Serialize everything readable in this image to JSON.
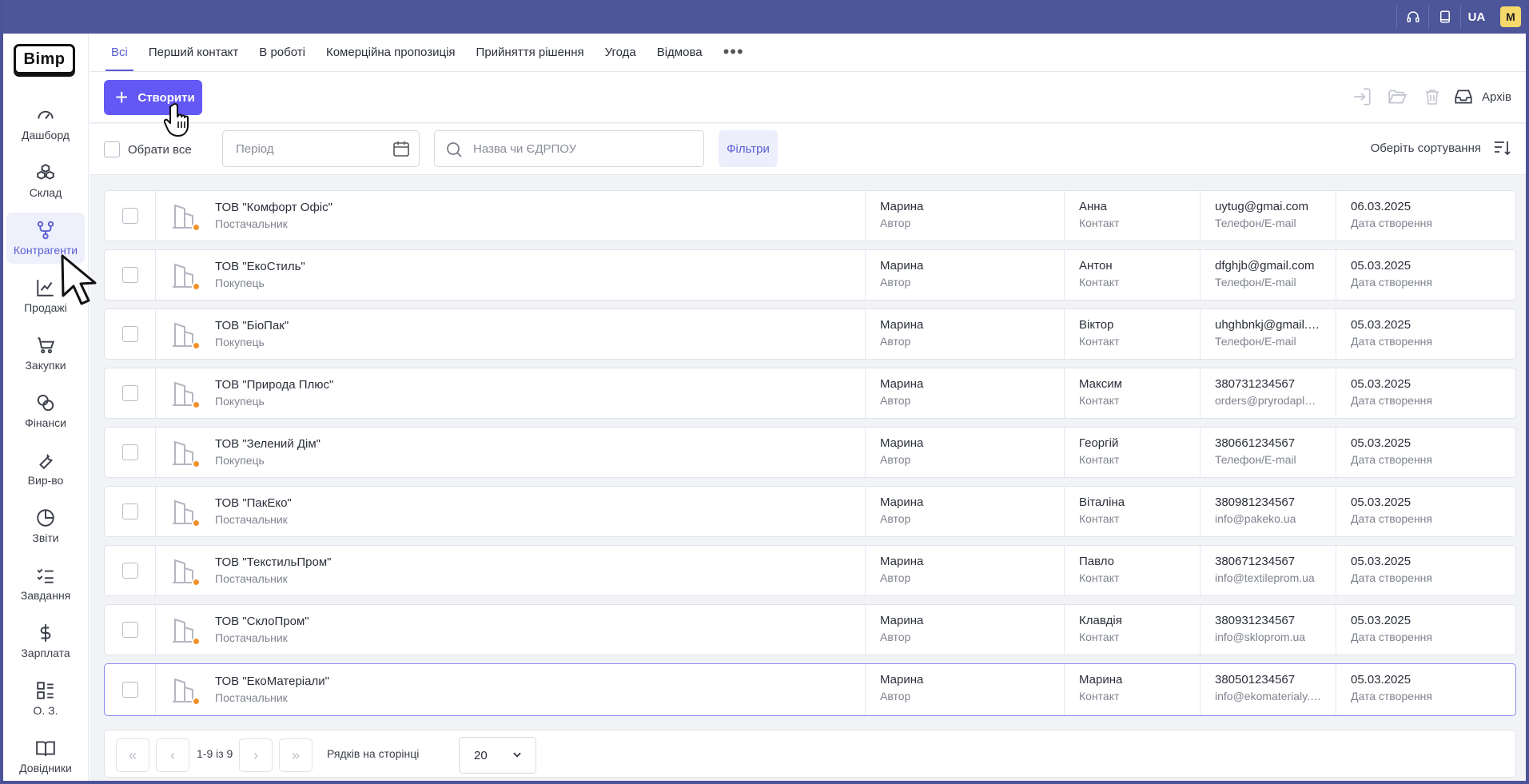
{
  "topbar": {
    "lang": "UA",
    "user_initial": "M",
    "icons": [
      "headset-icon",
      "book-icon"
    ]
  },
  "brand": {
    "logo_text": "Bimp"
  },
  "sidebar": {
    "items": [
      {
        "label": "Дашборд",
        "icon": "gauge-icon"
      },
      {
        "label": "Склад",
        "icon": "boxes-icon"
      },
      {
        "label": "Контрагенти",
        "icon": "network-icon",
        "active": true
      },
      {
        "label": "Продажі",
        "icon": "line-chart-icon"
      },
      {
        "label": "Закупки",
        "icon": "cart-icon"
      },
      {
        "label": "Фінанси",
        "icon": "coins-icon"
      },
      {
        "label": "Вир-во",
        "icon": "wrench-icon"
      },
      {
        "label": "Звіти",
        "icon": "pie-chart-icon"
      },
      {
        "label": "Завдання",
        "icon": "checklist-icon"
      },
      {
        "label": "Зарплата",
        "icon": "dollar-icon"
      },
      {
        "label": "О. З.",
        "icon": "assets-icon"
      },
      {
        "label": "Довідники",
        "icon": "open-book-icon"
      }
    ]
  },
  "tabs": [
    {
      "label": "Всі",
      "active": true
    },
    {
      "label": "Перший контакт"
    },
    {
      "label": "В роботі"
    },
    {
      "label": "Комерційна пропозиція"
    },
    {
      "label": "Прийняття рішення"
    },
    {
      "label": "Угода"
    },
    {
      "label": "Відмова"
    },
    {
      "label": "•••"
    }
  ],
  "toolbar": {
    "create_label": "Створити",
    "archive_label": "Архів"
  },
  "filters": {
    "select_all": "Обрати все",
    "period_placeholder": "Період",
    "search_placeholder": "Назва чи ЄДРПОУ",
    "filter_label": "Фільтри",
    "sort_label": "Оберіть сортування"
  },
  "rows": [
    {
      "name": "ТОВ \"Комфорт Офіс\"",
      "type": "Постачальник",
      "author": "Марина",
      "author_sub": "Автор",
      "contact": "Анна",
      "contact_sub": "Контакт",
      "phone": "uytug@gmai.com",
      "phone_sub": "Телефон/E-mail",
      "date": "06.03.2025",
      "date_sub": "Дата створення"
    },
    {
      "name": "ТОВ \"ЕкоСтиль\"",
      "type": "Покупець",
      "author": "Марина",
      "author_sub": "Автор",
      "contact": "Антон",
      "contact_sub": "Контакт",
      "phone": "dfghjb@gmail.com",
      "phone_sub": "Телефон/E-mail",
      "date": "05.03.2025",
      "date_sub": "Дата створення"
    },
    {
      "name": "ТОВ \"БіоПак\"",
      "type": "Покупець",
      "author": "Марина",
      "author_sub": "Автор",
      "contact": "Віктор",
      "contact_sub": "Контакт",
      "phone": "uhghbnkj@gmail.c...",
      "phone_sub": "Телефон/E-mail",
      "date": "05.03.2025",
      "date_sub": "Дата створення"
    },
    {
      "name": "ТОВ \"Природа Плюс\"",
      "type": "Покупець",
      "author": "Марина",
      "author_sub": "Автор",
      "contact": "Максим",
      "contact_sub": "Контакт",
      "phone": "380731234567",
      "phone_sub": "orders@pryrodaplus...",
      "date": "05.03.2025",
      "date_sub": "Дата створення"
    },
    {
      "name": "ТОВ \"Зелений Дім\"",
      "type": "Покупець",
      "author": "Марина",
      "author_sub": "Автор",
      "contact": "Георгій",
      "contact_sub": "Контакт",
      "phone": "380661234567",
      "phone_sub": "Телефон/E-mail",
      "date": "05.03.2025",
      "date_sub": "Дата створення"
    },
    {
      "name": "ТОВ \"ПакЕко\"",
      "type": "Постачальник",
      "author": "Марина",
      "author_sub": "Автор",
      "contact": "Віталіна",
      "contact_sub": "Контакт",
      "phone": "380981234567",
      "phone_sub": "info@pakeko.ua",
      "date": "05.03.2025",
      "date_sub": "Дата створення"
    },
    {
      "name": "ТОВ \"ТекстильПром\"",
      "type": "Постачальник",
      "author": "Марина",
      "author_sub": "Автор",
      "contact": "Павло",
      "contact_sub": "Контакт",
      "phone": "380671234567",
      "phone_sub": "info@textileprom.ua",
      "date": "05.03.2025",
      "date_sub": "Дата створення"
    },
    {
      "name": "ТОВ \"СклоПром\"",
      "type": "Постачальник",
      "author": "Марина",
      "author_sub": "Автор",
      "contact": "Клавдія",
      "contact_sub": "Контакт",
      "phone": "380931234567",
      "phone_sub": "info@skloprom.ua",
      "date": "05.03.2025",
      "date_sub": "Дата створення"
    },
    {
      "name": "ТОВ \"ЕкоМатеріали\"",
      "type": "Постачальник",
      "author": "Марина",
      "author_sub": "Автор",
      "contact": "Марина",
      "contact_sub": "Контакт",
      "phone": "380501234567",
      "phone_sub": "info@ekomaterialy.ua",
      "date": "05.03.2025",
      "date_sub": "Дата створення",
      "selected": true
    }
  ],
  "pager": {
    "range": "1-9 із 9",
    "rows_label": "Рядків на сторінці",
    "page_size": "20"
  },
  "colors": {
    "accent": "#6358f5",
    "topbar": "#4d5699",
    "status_dot": "#f3912a"
  }
}
